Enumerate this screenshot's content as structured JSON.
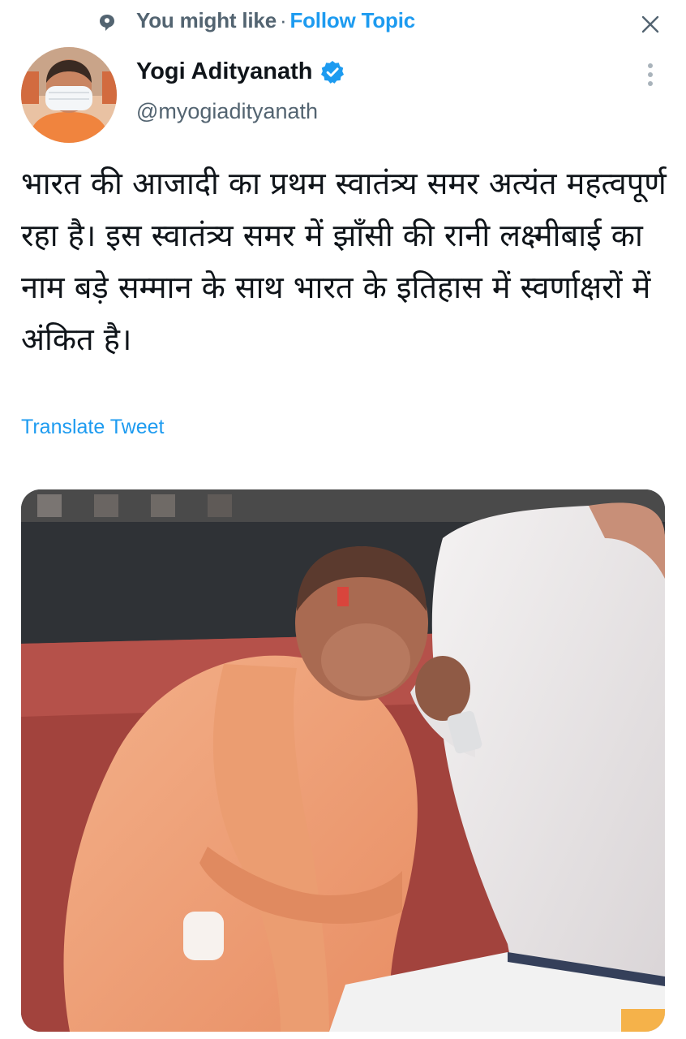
{
  "header": {
    "topic_icon": "topic-icon",
    "you_might_like": "You might like",
    "separator": "·",
    "follow_topic": "Follow Topic",
    "close_icon": "close-icon"
  },
  "tweet": {
    "author": {
      "display_name": "Yogi Adityanath",
      "handle": "@myogiadityanath",
      "verified_icon": "verified-badge-icon",
      "avatar_icon": "avatar"
    },
    "more_icon": "more-vertical-icon",
    "text": "भारत की आजादी का प्रथम स्वातंत्र्य समर अत्यंत महत्वपूर्ण रहा है। इस स्वातंत्र्य समर में झाँसी की रानी लक्ष्मीबाई का नाम बड़े सम्मान के साथ भारत के इतिहास में स्वर्णाक्षरों में अंकित है।",
    "translate_label": "Translate Tweet",
    "media_icon": "tweet-photo"
  },
  "colors": {
    "accent": "#1d9bf0",
    "text_primary": "#0f1419",
    "text_secondary": "#536471",
    "saffron": "#f2a071"
  }
}
